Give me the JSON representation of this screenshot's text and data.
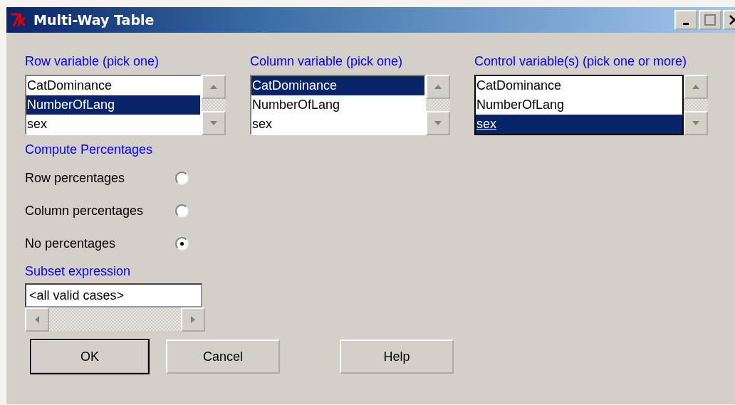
{
  "window": {
    "title": "Multi-Way Table"
  },
  "listboxes": [
    {
      "label": "Row variable (pick one)",
      "focused": false,
      "items": [
        {
          "label": "CatDominance",
          "selected": false
        },
        {
          "label": "NumberOfLang",
          "selected": true
        },
        {
          "label": "sex",
          "selected": false
        }
      ]
    },
    {
      "label": "Column variable (pick one)",
      "focused": false,
      "items": [
        {
          "label": "CatDominance",
          "selected": true
        },
        {
          "label": "NumberOfLang",
          "selected": false
        },
        {
          "label": "sex",
          "selected": false
        }
      ]
    },
    {
      "label": "Control variable(s) (pick one or more)",
      "focused": true,
      "items": [
        {
          "label": "CatDominance",
          "selected": false
        },
        {
          "label": "NumberOfLang",
          "selected": false
        },
        {
          "label": "sex",
          "selected": true
        }
      ]
    }
  ],
  "percentages": {
    "label": "Compute Percentages",
    "options": [
      {
        "label": "Row percentages",
        "selected": false
      },
      {
        "label": "Column percentages",
        "selected": false
      },
      {
        "label": "No percentages",
        "selected": true
      }
    ]
  },
  "subset": {
    "label": "Subset expression",
    "value": "<all valid cases>"
  },
  "buttons": [
    {
      "label": "OK",
      "default": true
    },
    {
      "label": "Cancel",
      "default": false
    },
    {
      "label": "Help",
      "default": false
    }
  ]
}
